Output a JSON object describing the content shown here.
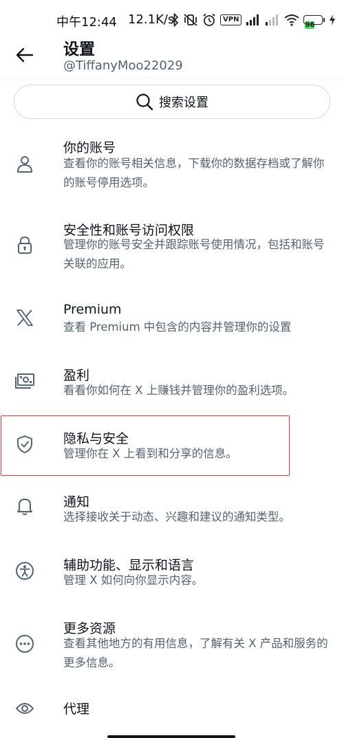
{
  "status_bar": {
    "time": "中午12:44",
    "speed": "12.1K/s",
    "vpn": "VPN",
    "battery": "96"
  },
  "header": {
    "title": "设置",
    "handle": "@TiffanyMoo22029"
  },
  "search": {
    "placeholder": "搜索设置"
  },
  "items": [
    {
      "label": "你的账号",
      "desc": "查看你的账号相关信息，下载你的数据存档或了解你的账号停用选项。",
      "icon": "person-icon"
    },
    {
      "label": "安全性和账号访问权限",
      "desc": "管理你的账号安全并跟踪账号使用情况，包括和账号关联的应用。",
      "icon": "lock-icon"
    },
    {
      "label": "Premium",
      "desc": "查看 Premium 中包含的内容并管理你的设置",
      "icon": "x-logo-icon"
    },
    {
      "label": "盈利",
      "desc": "看看你如何在 X 上赚钱并管理你的盈利选项。",
      "icon": "money-icon"
    },
    {
      "label": "隐私与安全",
      "desc": "管理你在 X 上看到和分享的信息。",
      "icon": "shield-check-icon"
    },
    {
      "label": "通知",
      "desc": "选择接收关于动态、兴趣和建议的通知类型。",
      "icon": "bell-icon"
    },
    {
      "label": "辅助功能、显示和语言",
      "desc": "管理 X 如何向你显示内容。",
      "icon": "accessibility-icon"
    },
    {
      "label": "更多资源",
      "desc": "查看其他地方的有用信息，了解有关 X 产品和服务的更多信息。",
      "icon": "more-circle-icon"
    },
    {
      "label": "代理",
      "desc": "",
      "icon": "eye-icon"
    }
  ],
  "highlight_color": "#e53935"
}
